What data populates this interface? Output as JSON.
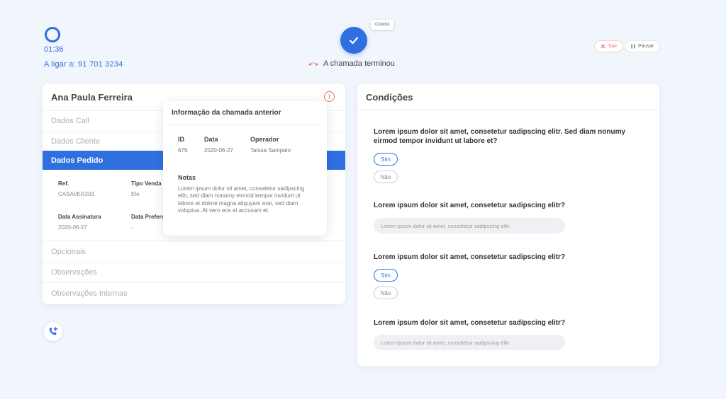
{
  "header": {
    "timer": "01:36",
    "dialing": "A ligar a: 91 701 3234",
    "status": "A chamada terminou",
    "tooltip": "Concluí",
    "exit_label": "Sair",
    "pause_label": "Pausar"
  },
  "customer": {
    "name": "Ana Paula Ferreira",
    "sections": {
      "call": "Dados Call",
      "client": "Dados Cliente",
      "order": "Dados Pedido",
      "optionals": "Opcionais",
      "notes": "Observações",
      "internal_notes": "Observações Internas"
    },
    "order_fields": {
      "ref_label": "Ref.",
      "ref_value": "CASAVER203",
      "sale_type_label": "Tipo Venda",
      "sale_type_value": "Ele",
      "signature_date_label": "Data Assinatura",
      "signature_date_value": "2020-06-27",
      "pref_date_label": "Data Prefere",
      "pref_date_value": "-"
    }
  },
  "previous_call": {
    "title": "Informação da chamada anterior",
    "id_label": "ID",
    "id_value": "679",
    "date_label": "Data",
    "date_value": "2020-06-27",
    "operator_label": "Operador",
    "operator_value": "Taíssa Sampaio",
    "notes_label": "Notas",
    "notes": "Lorem ipsum dolor sit amet, consetetur sadipscing elitr, sed diam nonumy eirmod tempor invidunt ut labore et dolore magna aliquyam erat, sed diam voluptua. At vero eos et accusam et."
  },
  "conditions": {
    "title": "Condições",
    "q1": "Lorem ipsum dolor sit amet, consetetur sadipscing elitr. Sed diam nonumy eirmod tempor invidunt ut labore et?",
    "q2": "Lorem ipsum dolor sit amet, consetetur sadipscing elitr?",
    "q3": "Lorem ipsum dolor sit amet, consetetur sadipscing elitr?",
    "q4": "Lorem ipsum dolor sit amet, consetetur sadipscing elitr?",
    "yes": "Sim",
    "no": "Não",
    "input_placeholder": "Lorem ipsum dolor sit amet, consetetur sadipscing elitr."
  },
  "colors": {
    "primary": "#2f6fe0",
    "danger": "#e8735f",
    "background": "#f1f5fc"
  }
}
